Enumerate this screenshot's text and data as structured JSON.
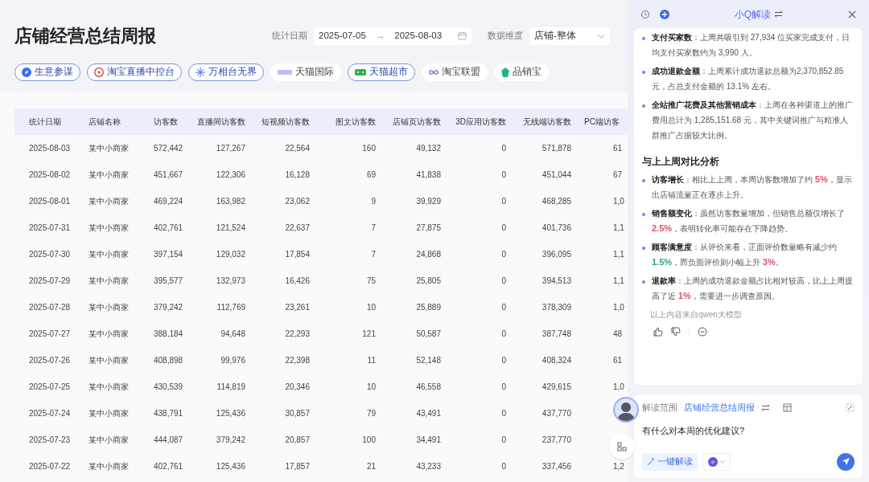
{
  "title": "店铺经营总结周报",
  "date_filter": {
    "label": "统计日期",
    "start": "2025-07-05",
    "arrow": "→",
    "end": "2025-08-03"
  },
  "dimension_filter": {
    "label": "数据维度",
    "value": "店铺-整体"
  },
  "channel_tags": [
    {
      "label": "生意参谋",
      "kind": "outlined"
    },
    {
      "label": "淘宝直播中控台",
      "kind": "outlined"
    },
    {
      "label": "万相台无界",
      "kind": "outlined"
    },
    {
      "label": "天猫国际",
      "kind": "plain"
    },
    {
      "label": "天猫超市",
      "kind": "outlined"
    },
    {
      "label": "淘宝联盟",
      "kind": "plain"
    },
    {
      "label": "品销宝",
      "kind": "plain"
    }
  ],
  "table": {
    "columns": [
      "统计日期",
      "店铺名称",
      "访客数",
      "直播间访客数",
      "短视频访客数",
      "图文访客数",
      "店铺页访客数",
      "3D应用访客数",
      "无线端访客数",
      "PC端访客"
    ],
    "rows": [
      [
        "2025-08-03",
        "某中小商家",
        "572,442",
        "127,267",
        "22,564",
        "160",
        "49,132",
        "0",
        "571,878",
        "61"
      ],
      [
        "2025-08-02",
        "某中小商家",
        "451,667",
        "122,306",
        "16,128",
        "69",
        "41,838",
        "0",
        "451,044",
        "67"
      ],
      [
        "2025-08-01",
        "某中小商家",
        "469,224",
        "163,982",
        "23,062",
        "9",
        "39,929",
        "0",
        "468,285",
        "1,0"
      ],
      [
        "2025-07-31",
        "某中小商家",
        "402,761",
        "121,524",
        "22,637",
        "7",
        "27,875",
        "0",
        "401,736",
        "1,1"
      ],
      [
        "2025-07-30",
        "某中小商家",
        "397,154",
        "129,032",
        "17,854",
        "7",
        "24,868",
        "0",
        "396,095",
        "1,1"
      ],
      [
        "2025-07-29",
        "某中小商家",
        "395,577",
        "132,973",
        "16,426",
        "75",
        "25,805",
        "0",
        "394,513",
        "1,1"
      ],
      [
        "2025-07-28",
        "某中小商家",
        "379,242",
        "112,769",
        "23,261",
        "10",
        "25,889",
        "0",
        "378,309",
        "1,0"
      ],
      [
        "2025-07-27",
        "某中小商家",
        "388,184",
        "94,648",
        "22,293",
        "121",
        "50,587",
        "0",
        "387,748",
        "48"
      ],
      [
        "2025-07-26",
        "某中小商家",
        "408,898",
        "99,976",
        "22,398",
        "11",
        "52,148",
        "0",
        "408,324",
        "61"
      ],
      [
        "2025-07-25",
        "某中小商家",
        "430,539",
        "114,819",
        "20,346",
        "10",
        "46,558",
        "0",
        "429,615",
        "1,0"
      ],
      [
        "2025-07-24",
        "某中小商家",
        "438,791",
        "125,436",
        "30,857",
        "79",
        "43,491",
        "0",
        "437,770"
      ],
      [
        "2025-07-23",
        "某中小商家",
        "444,087",
        "379,242",
        "20,857",
        "100",
        "34,491",
        "0",
        "237,770"
      ],
      [
        "2025-07-22",
        "某中小商家",
        "402,761",
        "125,436",
        "17,857",
        "21",
        "43,233",
        "0",
        "337,456",
        "1,2"
      ]
    ]
  },
  "assistant": {
    "title": "小Q解读",
    "sections": [
      {
        "items": [
          {
            "label": "支付买家数",
            "parts": [
              {
                "text": "：上周共吸引到 27,934 位买家完成支付，日均支付买家数约为 3,990 人。"
              }
            ]
          },
          {
            "label": "成功退款金额",
            "parts": [
              {
                "text": "：上周累计成功退款总额为2,370,852.85 元，占总支付金额的 13.1% 左右。"
              }
            ]
          },
          {
            "label": "全站推广花费及其他营销成本",
            "parts": [
              {
                "text": "：上周在各种渠道上的推广费用总计为 1,285,151.68 元，其中关键词推广与精准人群推广占据较大比例。"
              }
            ]
          }
        ]
      },
      {
        "heading": "与上上周对比分析",
        "items": [
          {
            "label": "访客增长",
            "parts": [
              {
                "text": "：相比上上周，本周访客数增加了约 "
              },
              {
                "text": "5%",
                "color": "#e0506a"
              },
              {
                "text": "，显示出店铺流量正在逐步上升。"
              }
            ]
          },
          {
            "label": "销售额变化",
            "parts": [
              {
                "text": "：虽然访客数量增加，但销售总额仅增长了 "
              },
              {
                "text": "2.5%",
                "color": "#e0506a"
              },
              {
                "text": "，表明转化率可能存在下降趋势。"
              }
            ]
          },
          {
            "label": "顾客满意度",
            "parts": [
              {
                "text": "：从评价来看，正面评价数量略有减少约 "
              },
              {
                "text": "1.5%",
                "color": "#2aa876"
              },
              {
                "text": "，而负面评价则小幅上升 "
              },
              {
                "text": "3%",
                "color": "#e0506a"
              },
              {
                "text": "。"
              }
            ]
          },
          {
            "label": "退款率",
            "parts": [
              {
                "text": "：上周的成功退款金额占比相对较高，比上上周提高了近 "
              },
              {
                "text": "1%",
                "color": "#e0506a"
              },
              {
                "text": "，需要进一步调查原因。"
              }
            ]
          }
        ]
      }
    ],
    "source_note": "以上内容来自qwen大模型",
    "composer": {
      "scope_label": "解读范围",
      "scope_value": "店铺经营总结周报",
      "question": "有什么对本周的优化建议?",
      "quick_button": "一键解读"
    }
  }
}
